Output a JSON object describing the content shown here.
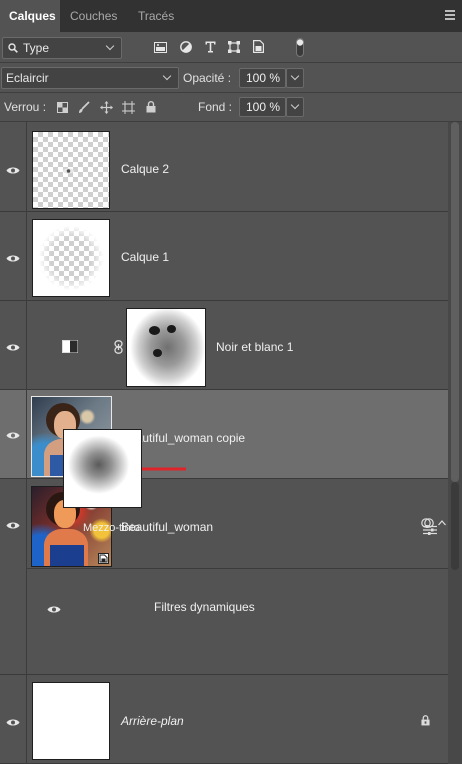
{
  "tabs": [
    {
      "label": "Calques",
      "active": true
    },
    {
      "label": "Couches",
      "active": false
    },
    {
      "label": "Tracés",
      "active": false
    }
  ],
  "filter": {
    "kind_label": "Type"
  },
  "blend": {
    "mode": "Eclaircir",
    "opacity_label": "Opacité :",
    "opacity_value": "100 %"
  },
  "lock": {
    "label": "Verrou :",
    "fill_label": "Fond :",
    "fill_value": "100 %"
  },
  "layers": [
    {
      "name": "Calque 2"
    },
    {
      "name": "Calque 1"
    },
    {
      "name": "Noir et blanc 1"
    },
    {
      "name": "Beautiful_woman  copie",
      "selected": true
    },
    {
      "name": "Beautiful_woman"
    },
    {
      "name": "Filtres dynamiques"
    },
    {
      "name": "Mezzo-tinto"
    },
    {
      "name": "Arrière-plan",
      "italic": true
    }
  ],
  "colors": {
    "panel": "#535353",
    "selected": "#6e6e6e",
    "arrow": "#e0242a",
    "tabbar": "#323232"
  }
}
